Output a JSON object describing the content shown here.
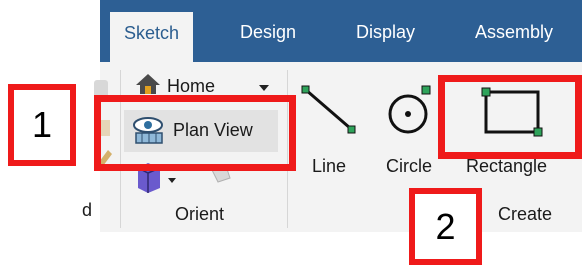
{
  "ribbon": {
    "tabs": [
      {
        "label": "Sketch",
        "active": true
      },
      {
        "label": "Design",
        "active": false
      },
      {
        "label": "Display",
        "active": false
      },
      {
        "label": "Assembly",
        "active": false
      }
    ],
    "orient": {
      "home_label": "Home",
      "plan_view_label": "Plan View",
      "group_label": "Orient"
    },
    "create": {
      "line_label": "Line",
      "circle_label": "Circle",
      "rectangle_label": "Rectangle",
      "group_label": "Create"
    },
    "clipped_group_label": "d"
  },
  "annotations": {
    "callout_1": "1",
    "callout_2": "2"
  },
  "colors": {
    "ribbon_blue": "#2d5f94",
    "highlight_red": "#ef1a1a",
    "handle_green": "#2ea35a"
  }
}
